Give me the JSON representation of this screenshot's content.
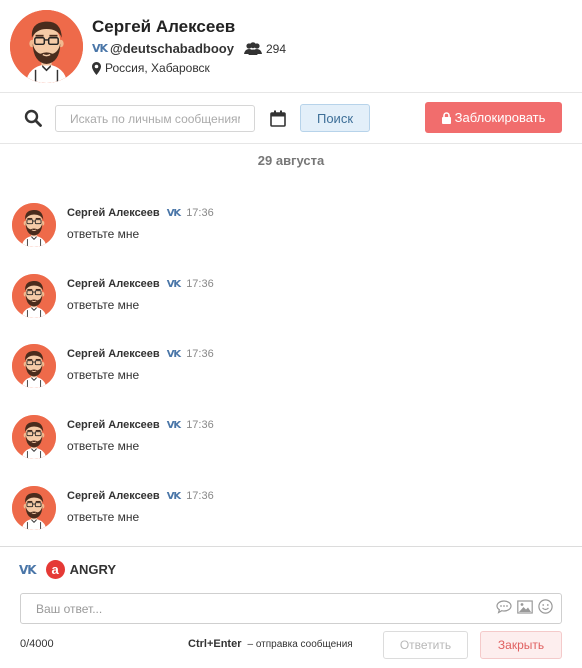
{
  "profile": {
    "name": "Сергей Алексеев",
    "handle": "@deutschabadbooy",
    "friends_count": "294",
    "location": "Россия, Хабаровск",
    "avatar_icon": "hipster-avatar-icon",
    "network_icon": "vk-icon"
  },
  "toolbar": {
    "search_placeholder": "Искать по личным сообщениям",
    "search_button": "Поиск",
    "block_button": "Заблокировать"
  },
  "messages": {
    "date_separator": "29 августа",
    "items": [
      {
        "author": "Сергей Алексеев",
        "time": "17:36",
        "text": "ответьте мне"
      },
      {
        "author": "Сергей Алексеев",
        "time": "17:36",
        "text": "ответьте мне"
      },
      {
        "author": "Сергей Алексеев",
        "time": "17:36",
        "text": "ответьте мне"
      },
      {
        "author": "Сергей Алексеев",
        "time": "17:36",
        "text": "ответьте мне"
      },
      {
        "author": "Сергей Алексеев",
        "time": "17:36",
        "text": "ответьте мне"
      }
    ]
  },
  "composer": {
    "account_name": "ANGRY",
    "account_logo_letter": "a",
    "reply_placeholder": "Ваш ответ...",
    "counter": "0/4000",
    "hint_keys": "Ctrl+Enter",
    "hint_text": "– отправка сообщения",
    "reply_button": "Ответить",
    "close_button": "Закрыть"
  },
  "colors": {
    "vk_blue": "#4a76a8",
    "block_red": "#f16d6d",
    "avatar_orange": "#ee6a4a",
    "angry_red": "#e53935"
  }
}
